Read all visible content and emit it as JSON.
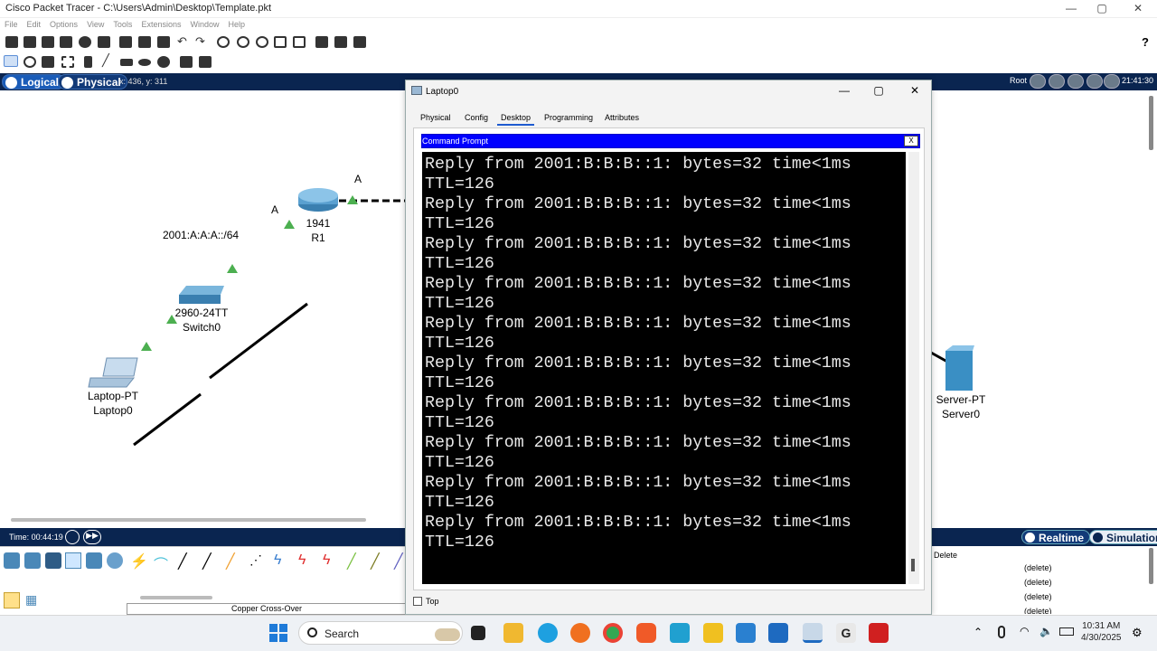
{
  "window": {
    "title": "Cisco Packet Tracer - C:\\Users\\Admin\\Desktop\\Template.pkt",
    "minimize": "—",
    "maximize": "▢",
    "close": "✕"
  },
  "menu": [
    "File",
    "Edit",
    "Options",
    "View",
    "Tools",
    "Extensions",
    "Window",
    "Help"
  ],
  "help_icon": "?",
  "viewbar": {
    "logical": "Logical",
    "physical": "Physical",
    "coords": "x: 436, y: 311",
    "root": "Root",
    "clock": "21:41:30"
  },
  "topology": {
    "link_label_a1": "A",
    "link_label_a2": "A",
    "network": "2001:A:A:A::/64",
    "router_model": "1941",
    "router_name": "R1",
    "switch_model": "2960-24TT",
    "switch_name": "Switch0",
    "laptop_model": "Laptop-PT",
    "laptop_name": "Laptop0",
    "server_model": "Server-PT",
    "server_name": "Server0"
  },
  "timebar": {
    "time": "Time: 00:44:19",
    "realtime": "Realtime",
    "simulation": "Simulation"
  },
  "palette": {
    "connection_label": "Copper Cross-Over"
  },
  "events": {
    "header": "Delete",
    "rows": [
      "(delete)",
      "(delete)",
      "(delete)",
      "(delete)"
    ]
  },
  "dialog": {
    "title": "Laptop0",
    "minimize": "—",
    "maximize": "▢",
    "close": "✕",
    "tabs": [
      "Physical",
      "Config",
      "Desktop",
      "Programming",
      "Attributes"
    ],
    "active_tab": "Desktop",
    "app_title": "Command Prompt",
    "app_close": "X",
    "top_checkbox": "Top",
    "terminal_lines": [
      "TTL=126",
      "Reply from 2001:B:B:B::1: bytes=32 time<1ms",
      "TTL=126",
      "Reply from 2001:B:B:B::1: bytes=32 time<1ms",
      "TTL=126",
      "Reply from 2001:B:B:B::1: bytes=32 time<1ms",
      "TTL=126",
      "Reply from 2001:B:B:B::1: bytes=32 time<1ms",
      "TTL=126",
      "Reply from 2001:B:B:B::1: bytes=32 time<1ms",
      "TTL=126",
      "Reply from 2001:B:B:B::1: bytes=32 time<1ms",
      "TTL=126",
      "Reply from 2001:B:B:B::1: bytes=32 time<1ms",
      "TTL=126",
      "Reply from 2001:B:B:B::1: bytes=32 time<1ms",
      "TTL=126",
      "Reply from 2001:B:B:B::1: bytes=32 time<1ms",
      "TTL=126",
      "Reply from 2001:B:B:B::1: bytes=32 time<1ms",
      "TTL=126"
    ]
  },
  "taskbar": {
    "search": "Search",
    "time": "10:31 AM",
    "date": "4/30/2025"
  },
  "colors": {
    "viewbar_bg": "#0a2550",
    "cmd_titlebar": "#0000ff",
    "link_up": "#4caf50"
  }
}
